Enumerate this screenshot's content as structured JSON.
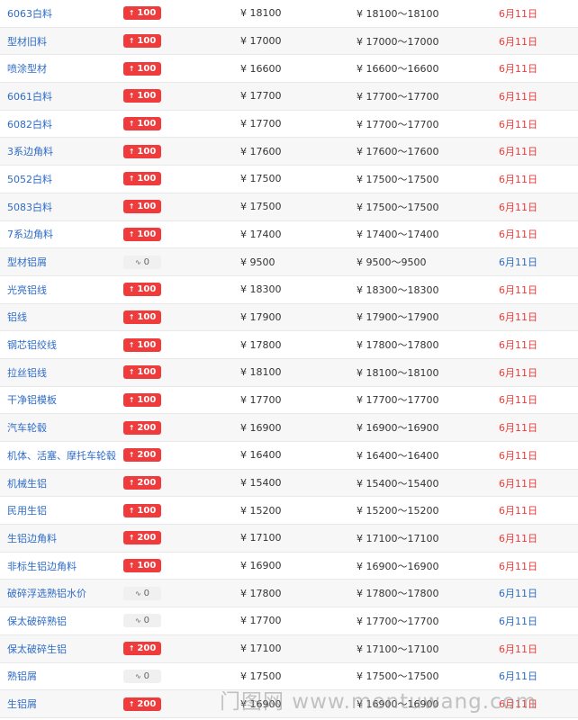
{
  "rows": [
    {
      "name": "6063白料",
      "change_icon": "up-arrow-icon",
      "change": "100",
      "price": "¥ 18100",
      "range": "¥ 18100～18100",
      "date": "6月11日",
      "trend": "up"
    },
    {
      "name": "型材旧料",
      "change_icon": "up-arrow-icon",
      "change": "100",
      "price": "¥ 17000",
      "range": "¥ 17000～17000",
      "date": "6月11日",
      "trend": "up"
    },
    {
      "name": "喷涂型材",
      "change_icon": "up-arrow-icon",
      "change": "100",
      "price": "¥ 16600",
      "range": "¥ 16600～16600",
      "date": "6月11日",
      "trend": "up"
    },
    {
      "name": "6061白料",
      "change_icon": "up-arrow-icon",
      "change": "100",
      "price": "¥ 17700",
      "range": "¥ 17700～17700",
      "date": "6月11日",
      "trend": "up"
    },
    {
      "name": "6082白料",
      "change_icon": "up-arrow-icon",
      "change": "100",
      "price": "¥ 17700",
      "range": "¥ 17700～17700",
      "date": "6月11日",
      "trend": "up"
    },
    {
      "name": "3系边角料",
      "change_icon": "up-arrow-icon",
      "change": "100",
      "price": "¥ 17600",
      "range": "¥ 17600～17600",
      "date": "6月11日",
      "trend": "up"
    },
    {
      "name": "5052白料",
      "change_icon": "up-arrow-icon",
      "change": "100",
      "price": "¥ 17500",
      "range": "¥ 17500～17500",
      "date": "6月11日",
      "trend": "up"
    },
    {
      "name": "5083白料",
      "change_icon": "up-arrow-icon",
      "change": "100",
      "price": "¥ 17500",
      "range": "¥ 17500～17500",
      "date": "6月11日",
      "trend": "up"
    },
    {
      "name": "7系边角料",
      "change_icon": "up-arrow-icon",
      "change": "100",
      "price": "¥ 17400",
      "range": "¥ 17400～17400",
      "date": "6月11日",
      "trend": "up"
    },
    {
      "name": "型材铝屑",
      "change_icon": "flat-icon",
      "change": "0",
      "price": "¥ 9500",
      "range": "¥ 9500～9500",
      "date": "6月11日",
      "trend": "flat"
    },
    {
      "name": "光亮铝线",
      "change_icon": "up-arrow-icon",
      "change": "100",
      "price": "¥ 18300",
      "range": "¥ 18300～18300",
      "date": "6月11日",
      "trend": "up"
    },
    {
      "name": "铝线",
      "change_icon": "up-arrow-icon",
      "change": "100",
      "price": "¥ 17900",
      "range": "¥ 17900～17900",
      "date": "6月11日",
      "trend": "up"
    },
    {
      "name": "钢芯铝绞线",
      "change_icon": "up-arrow-icon",
      "change": "100",
      "price": "¥ 17800",
      "range": "¥ 17800～17800",
      "date": "6月11日",
      "trend": "up"
    },
    {
      "name": "拉丝铝线",
      "change_icon": "up-arrow-icon",
      "change": "100",
      "price": "¥ 18100",
      "range": "¥ 18100～18100",
      "date": "6月11日",
      "trend": "up"
    },
    {
      "name": "干净铝模板",
      "change_icon": "up-arrow-icon",
      "change": "100",
      "price": "¥ 17700",
      "range": "¥ 17700～17700",
      "date": "6月11日",
      "trend": "up"
    },
    {
      "name": "汽车轮毂",
      "change_icon": "up-arrow-icon",
      "change": "200",
      "price": "¥ 16900",
      "range": "¥ 16900～16900",
      "date": "6月11日",
      "trend": "up"
    },
    {
      "name": "机体、活塞、摩托车轮毂",
      "change_icon": "up-arrow-icon",
      "change": "200",
      "price": "¥ 16400",
      "range": "¥ 16400～16400",
      "date": "6月11日",
      "trend": "up"
    },
    {
      "name": "机械生铝",
      "change_icon": "up-arrow-icon",
      "change": "200",
      "price": "¥ 15400",
      "range": "¥ 15400～15400",
      "date": "6月11日",
      "trend": "up"
    },
    {
      "name": "民用生铝",
      "change_icon": "up-arrow-icon",
      "change": "100",
      "price": "¥ 15200",
      "range": "¥ 15200～15200",
      "date": "6月11日",
      "trend": "up"
    },
    {
      "name": "生铝边角料",
      "change_icon": "up-arrow-icon",
      "change": "200",
      "price": "¥ 17100",
      "range": "¥ 17100～17100",
      "date": "6月11日",
      "trend": "up"
    },
    {
      "name": "非标生铝边角料",
      "change_icon": "up-arrow-icon",
      "change": "100",
      "price": "¥ 16900",
      "range": "¥ 16900～16900",
      "date": "6月11日",
      "trend": "up"
    },
    {
      "name": "破碎浮选熟铝水价",
      "change_icon": "flat-icon",
      "change": "0",
      "price": "¥ 17800",
      "range": "¥ 17800～17800",
      "date": "6月11日",
      "trend": "flat"
    },
    {
      "name": "保太破碎熟铝",
      "change_icon": "flat-icon",
      "change": "0",
      "price": "¥ 17700",
      "range": "¥ 17700～17700",
      "date": "6月11日",
      "trend": "flat"
    },
    {
      "name": "保太破碎生铝",
      "change_icon": "up-arrow-icon",
      "change": "200",
      "price": "¥ 17100",
      "range": "¥ 17100～17100",
      "date": "6月11日",
      "trend": "up"
    },
    {
      "name": "熟铝屑",
      "change_icon": "flat-icon",
      "change": "0",
      "price": "¥ 17500",
      "range": "¥ 17500～17500",
      "date": "6月11日",
      "trend": "flat"
    },
    {
      "name": "生铝屑",
      "change_icon": "up-arrow-icon",
      "change": "200",
      "price": "¥ 16900",
      "range": "¥ 16900～16900",
      "date": "6月11日",
      "trend": "up"
    }
  ],
  "icons": {
    "up": "↑",
    "flat": "∿"
  },
  "colors": {
    "up": "#ef3b3b",
    "flat_date": "#2f6cc7",
    "link": "#2f6cc7"
  },
  "watermark": "门图网 www.mentuwang.com"
}
